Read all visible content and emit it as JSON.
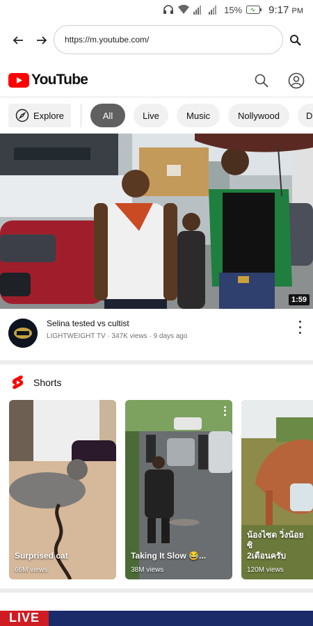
{
  "status_bar": {
    "battery": "15%",
    "time": "9:17",
    "ampm": "PM"
  },
  "browser": {
    "url": "https://m.youtube.com/"
  },
  "header": {
    "logo_text": "YouTube"
  },
  "chips": {
    "explore": "Explore",
    "items": [
      "All",
      "Live",
      "Music",
      "Nollywood",
      "D"
    ]
  },
  "featured_video": {
    "title": "Selina tested vs cultist",
    "channel": "LIGHTWEIGHT TV",
    "views": "347K views",
    "age": "9 days ago",
    "separator": "·",
    "duration": "1:59"
  },
  "shorts": {
    "section_title": "Shorts",
    "items": [
      {
        "title": "Surprised cat",
        "views": "66M views"
      },
      {
        "title": "Taking It Slow 😂...",
        "views": "38M views"
      },
      {
        "title": "น้องไซด วิ่งน้อยซิ\n2เดือนครับ",
        "views": "120M views"
      }
    ]
  },
  "bottom_banner": {
    "badge": "LIVE"
  },
  "colors": {
    "brand_red": "#ff0000",
    "chip_active": "#606060",
    "chip_bg": "#f1f1f1"
  }
}
